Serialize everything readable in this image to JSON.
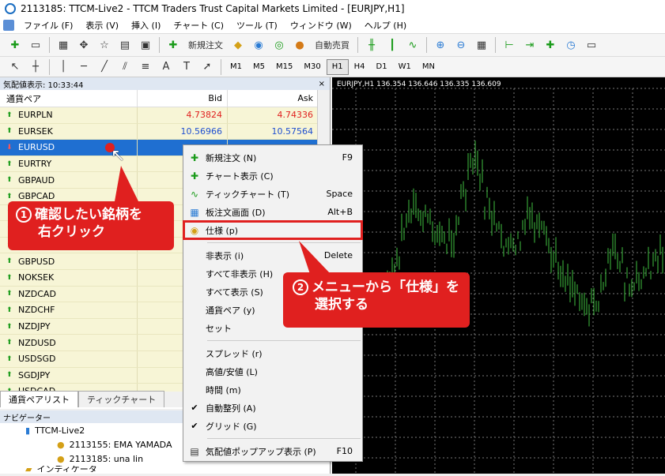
{
  "window": {
    "title": "2113185: TTCM-Live2 - TTCM Traders Trust Capital Markets Limited - [EURJPY,H1]"
  },
  "menu": [
    "ファイル (F)",
    "表示 (V)",
    "挿入 (I)",
    "チャート (C)",
    "ツール (T)",
    "ウィンドウ (W)",
    "ヘルプ (H)"
  ],
  "toolbar": {
    "new_order": "新規注文",
    "auto_trade": "自動売買"
  },
  "timeframes": [
    "M1",
    "M5",
    "M15",
    "M30",
    "H1",
    "H4",
    "D1",
    "W1",
    "MN"
  ],
  "active_timeframe": "H1",
  "market_watch": {
    "header": "気配値表示: 10:33:44",
    "columns": {
      "symbol": "通貨ペア",
      "bid": "Bid",
      "ask": "Ask"
    },
    "rows": [
      {
        "symbol": "EURPLN",
        "bid": "4.73824",
        "ask": "4.74336",
        "dir": "up",
        "color": "red"
      },
      {
        "symbol": "EURSEK",
        "bid": "10.56966",
        "ask": "10.57564",
        "dir": "up",
        "color": "blue"
      },
      {
        "symbol": "EURUSD",
        "bid": "",
        "ask": "",
        "dir": "dn",
        "color": "",
        "selected": true
      },
      {
        "symbol": "EURTRY",
        "dir": "up"
      },
      {
        "symbol": "GBPAUD",
        "dir": "up"
      },
      {
        "symbol": "GBPCAD",
        "dir": "up"
      },
      {
        "symbol": "",
        "dir": "up"
      },
      {
        "symbol": "",
        "dir": "up"
      },
      {
        "symbol": "",
        "dir": "up"
      },
      {
        "symbol": "GBPUSD",
        "dir": "up"
      },
      {
        "symbol": "NOKSEK",
        "dir": "up"
      },
      {
        "symbol": "NZDCAD",
        "dir": "up"
      },
      {
        "symbol": "NZDCHF",
        "dir": "up"
      },
      {
        "symbol": "NZDJPY",
        "dir": "up"
      },
      {
        "symbol": "NZDUSD",
        "dir": "up"
      },
      {
        "symbol": "USDSGD",
        "dir": "up"
      },
      {
        "symbol": "SGDJPY",
        "dir": "up"
      },
      {
        "symbol": "USDCAD",
        "dir": "up"
      }
    ],
    "tabs": [
      "通貨ペアリスト",
      "ティックチャート"
    ]
  },
  "navigator": {
    "header": "ナビゲーター",
    "items": [
      "TTCM-Live2",
      "2113155: EMA YAMADA",
      "2113185: una lin",
      "インディケータ"
    ]
  },
  "chart": {
    "label": "EURJPY,H1  136.354 136.646 136.335 136.609"
  },
  "context_menu": [
    {
      "label": "新規注文 (N)",
      "shortcut": "F9",
      "icon": "new-order-icon"
    },
    {
      "label": "チャート表示 (C)",
      "shortcut": "",
      "icon": "chart-icon"
    },
    {
      "label": "ティックチャート (T)",
      "shortcut": "Space",
      "icon": "tick-chart-icon"
    },
    {
      "label": "板注文画面 (D)",
      "shortcut": "Alt+B",
      "icon": "dom-icon"
    },
    {
      "label": "仕様 (p)",
      "shortcut": "",
      "icon": "spec-icon",
      "highlight": true
    },
    {
      "sep": true
    },
    {
      "label": "非表示 (i)",
      "shortcut": "Delete"
    },
    {
      "label": "すべて非表示 (H)",
      "shortcut": ""
    },
    {
      "label": "すべて表示 (S)",
      "shortcut": ""
    },
    {
      "label": "通貨ペア (y)",
      "shortcut": ""
    },
    {
      "label": "セット",
      "shortcut": ""
    },
    {
      "sep": true
    },
    {
      "label": "スプレッド (r)",
      "shortcut": ""
    },
    {
      "label": "高値/安値 (L)",
      "shortcut": ""
    },
    {
      "label": "時間 (m)",
      "shortcut": ""
    },
    {
      "label": "自動整列 (A)",
      "shortcut": "",
      "checked": true
    },
    {
      "label": "グリッド (G)",
      "shortcut": "",
      "checked": true
    },
    {
      "sep": true
    },
    {
      "label": "気配値ポップアップ表示 (P)",
      "shortcut": "F10",
      "icon": "popup-icon"
    }
  ],
  "callouts": {
    "one": {
      "num": "1",
      "line1": "確認したい銘柄を",
      "line2": "右クリック"
    },
    "two": {
      "num": "2",
      "line1": "メニューから「仕様」を",
      "line2": "選択する"
    }
  }
}
